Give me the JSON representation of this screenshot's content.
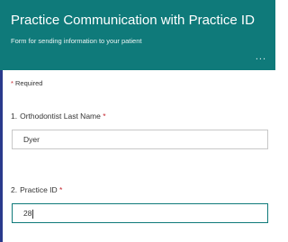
{
  "form": {
    "title": "Practice Communication with Practice ID",
    "subtitle": "Form for sending information to your patient",
    "more_label": "...",
    "required_note": "Required",
    "required_marker": "*"
  },
  "questions": [
    {
      "number": "1.",
      "label": "Orthodontist Last Name",
      "value": "Dyer",
      "required": true
    },
    {
      "number": "2.",
      "label": "Practice ID",
      "value": "28",
      "required": true,
      "focused": true
    }
  ],
  "colors": {
    "header_bg": "#0f7a7a",
    "required": "#c4262e",
    "accent_rule": "#2a3a8c"
  }
}
